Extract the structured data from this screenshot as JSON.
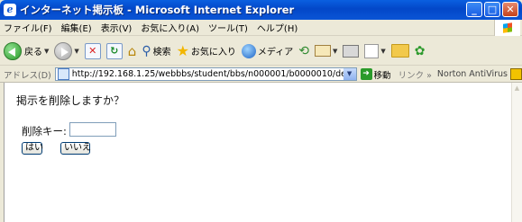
{
  "window": {
    "title": "インターネット掲示板 - Microsoft Internet Explorer",
    "controls": {
      "minimize": "_",
      "maximize": "□",
      "close": "✕"
    }
  },
  "menubar": {
    "items": [
      "ファイル(F)",
      "編集(E)",
      "表示(V)",
      "お気に入り(A)",
      "ツール(T)",
      "ヘルプ(H)"
    ]
  },
  "toolbar": {
    "back_label": "戻る",
    "search_label": "検索",
    "favorites_label": "お気に入り",
    "media_label": "メディア"
  },
  "addressbar": {
    "label": "アドレス(D)",
    "url": "http://192.168.1.25/webbbs/student/bbs/n000001/b0000010/delform.html",
    "go_label": "移動",
    "links_label": "リンク »",
    "norton_label": "Norton AntiVirus"
  },
  "page": {
    "question": "掲示を削除しますか？",
    "key_label": "削除キー:",
    "key_value": "",
    "yes_button": "はい",
    "no_button": "いいえ"
  }
}
